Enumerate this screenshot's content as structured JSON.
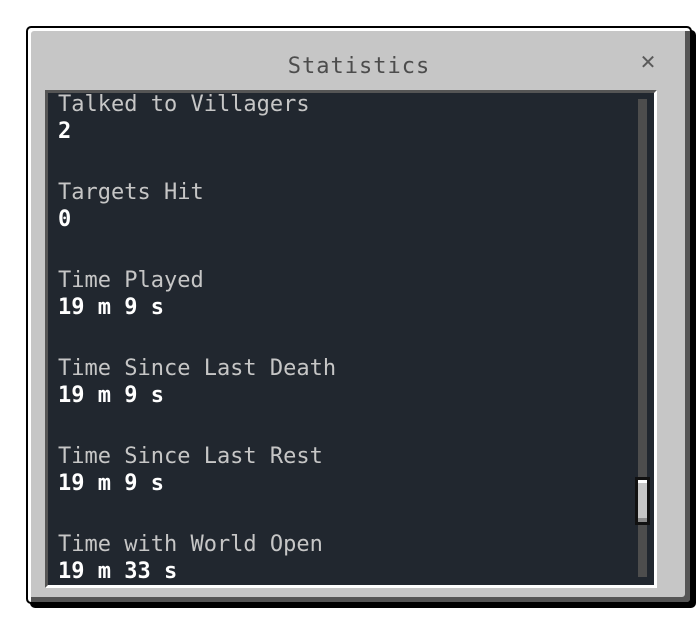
{
  "window": {
    "title": "Statistics",
    "close_icon": "close-icon",
    "close_glyph": "✕"
  },
  "stats": [
    {
      "label": "Talked to Villagers",
      "value": "2"
    },
    {
      "label": "Targets Hit",
      "value": "0"
    },
    {
      "label": "Time Played",
      "value": "19 m 9 s"
    },
    {
      "label": "Time Since Last Death",
      "value": "19 m 9 s"
    },
    {
      "label": "Time Since Last Rest",
      "value": "19 m 9 s"
    },
    {
      "label": "Time with World Open",
      "value": "19 m 33 s"
    }
  ],
  "scrollbar": {
    "position_fraction": 0.88
  },
  "colors": {
    "panel": "#c6c6c6",
    "content_bg": "#21272f",
    "label_text": "#c6c6c6",
    "value_text": "#ffffff",
    "title_text": "#4c4c4c"
  }
}
